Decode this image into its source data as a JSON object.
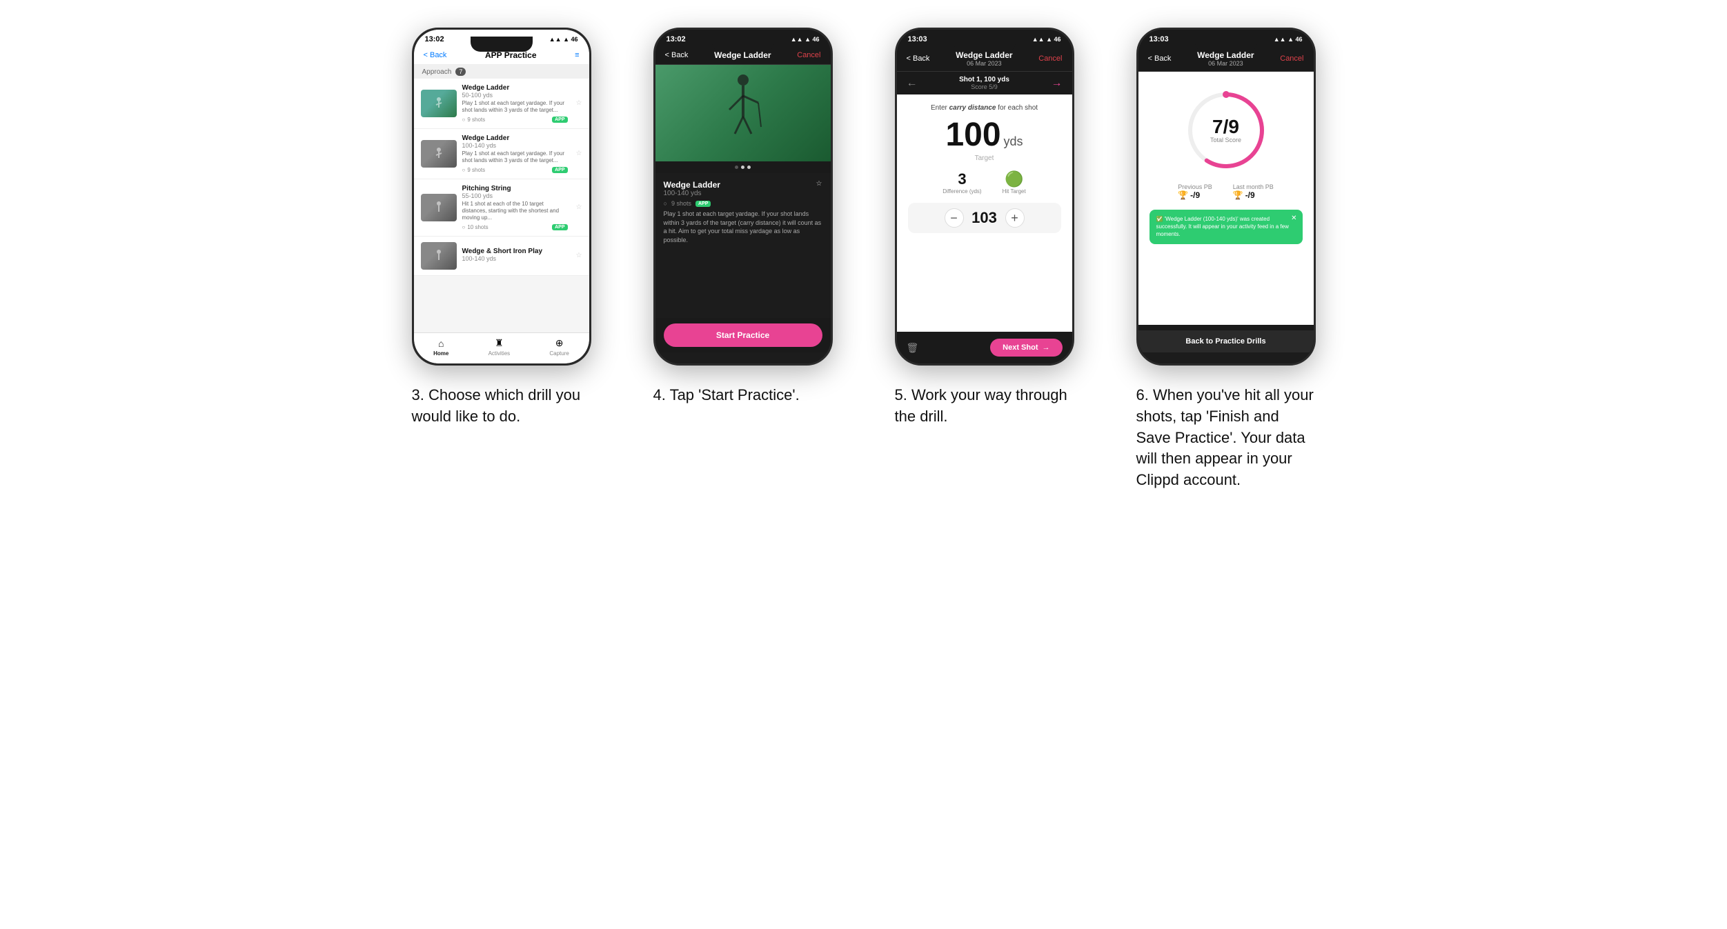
{
  "phones": [
    {
      "id": "phone3",
      "caption": "3. Choose which drill you would like to do.",
      "status": {
        "time": "13:02",
        "dark": false
      },
      "nav": {
        "back": "< Back",
        "title": "APP Practice",
        "action": "≡",
        "dark": false
      },
      "section": {
        "label": "Approach",
        "count": "7"
      },
      "drills": [
        {
          "name": "Wedge Ladder",
          "range": "50-100 yds",
          "desc": "Play 1 shot at each target yardage. If your shot lands within 3 yards of the target...",
          "shots": "9 shots",
          "badge": "APP",
          "color": "green"
        },
        {
          "name": "Wedge Ladder",
          "range": "100-140 yds",
          "desc": "Play 1 shot at each target yardage. If your shot lands within 3 yards of the target...",
          "shots": "9 shots",
          "badge": "APP",
          "color": "gray"
        },
        {
          "name": "Pitching String",
          "range": "55-100 yds",
          "desc": "Hit 1 shot at each of the 10 target distances, starting with the shortest and moving up...",
          "shots": "10 shots",
          "badge": "APP",
          "color": "gray"
        },
        {
          "name": "Wedge & Short Iron Play",
          "range": "100-140 yds",
          "desc": "",
          "shots": "",
          "badge": "",
          "color": "gray"
        }
      ],
      "tabs": [
        {
          "label": "Home",
          "icon": "⌂",
          "active": true
        },
        {
          "label": "Activities",
          "icon": "♜",
          "active": false
        },
        {
          "label": "Capture",
          "icon": "⊕",
          "active": false
        }
      ]
    },
    {
      "id": "phone4",
      "caption": "4. Tap 'Start Practice'.",
      "status": {
        "time": "13:02",
        "dark": true
      },
      "nav": {
        "back": "< Back",
        "title": "Wedge Ladder",
        "action": "Cancel",
        "dark": true
      },
      "drill_detail": {
        "name": "Wedge Ladder",
        "range": "100-140 yds",
        "shots": "9 shots",
        "badge": "APP",
        "desc": "Play 1 shot at each target yardage. If your shot lands within 3 yards of the target (carry distance) it will count as a hit. Aim to get your total miss yardage as low as possible.",
        "start_label": "Start Practice"
      },
      "dots": [
        true,
        false,
        false
      ]
    },
    {
      "id": "phone5",
      "caption": "5. Work your way through the drill.",
      "status": {
        "time": "13:03",
        "dark": true
      },
      "nav": {
        "back": "< Back",
        "title": "Wedge Ladder",
        "subtitle": "06 Mar 2023",
        "action": "Cancel",
        "dark": true
      },
      "shot_nav": {
        "shot_label": "Shot 1, 100 yds",
        "score_label": "Score 5/9"
      },
      "carry_instruction": "Enter carry distance for each shot",
      "target_yds": "100",
      "yds_unit": "yds",
      "target_word": "Target",
      "difference": "3",
      "difference_label": "Difference (yds)",
      "hit_target": "Hit Target",
      "input_value": "103",
      "next_shot_label": "Next Shot"
    },
    {
      "id": "phone6",
      "caption": "6. When you've hit all your shots, tap 'Finish and Save Practice'. Your data will then appear in your Clippd account.",
      "status": {
        "time": "13:03",
        "dark": true
      },
      "nav": {
        "back": "< Back",
        "title": "Wedge Ladder",
        "subtitle": "06 Mar 2023",
        "action": "Cancel",
        "dark": true
      },
      "score": {
        "value": "7/9",
        "label": "Total Score",
        "ring_percent": 77
      },
      "pb": {
        "previous_label": "Previous PB",
        "previous_value": "-/9",
        "last_month_label": "Last month PB",
        "last_month_value": "-/9"
      },
      "toast": "'Wedge Ladder (100-140 yds)' was created successfully. It will appear in your activity feed in a few moments.",
      "back_label": "Back to Practice Drills"
    }
  ]
}
